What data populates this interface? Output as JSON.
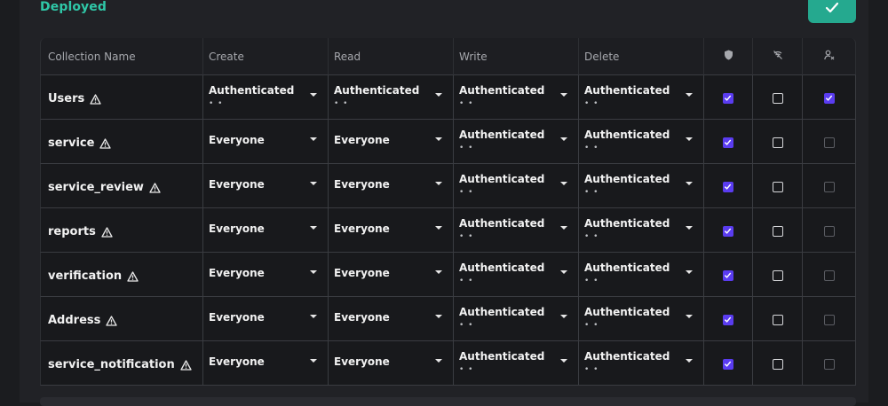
{
  "header": {
    "status_label": "Deployed",
    "deploy_button_icon": "check-icon",
    "accent_color": "#2fc8a8"
  },
  "table": {
    "columns": [
      "Collection Name",
      "Create",
      "Read",
      "Write",
      "Delete"
    ],
    "icon_columns": [
      "shield-icon",
      "no-signal-icon",
      "user-x-icon"
    ],
    "rows": [
      {
        "name": "Users",
        "create": "Authenticated",
        "read": "Authenticated",
        "write": "Authenticated",
        "delete": "Authenticated",
        "shield": true,
        "public": false,
        "self": true
      },
      {
        "name": "service",
        "create": "Everyone",
        "read": "Everyone",
        "write": "Authenticated",
        "delete": "Authenticated",
        "shield": true,
        "public": false,
        "self": false
      },
      {
        "name": "service_review",
        "create": "Everyone",
        "read": "Everyone",
        "write": "Authenticated",
        "delete": "Authenticated",
        "shield": true,
        "public": false,
        "self": false
      },
      {
        "name": "reports",
        "create": "Everyone",
        "read": "Everyone",
        "write": "Authenticated",
        "delete": "Authenticated",
        "shield": true,
        "public": false,
        "self": false
      },
      {
        "name": "verification",
        "create": "Everyone",
        "read": "Everyone",
        "write": "Authenticated",
        "delete": "Authenticated",
        "shield": true,
        "public": false,
        "self": false
      },
      {
        "name": "Address",
        "create": "Everyone",
        "read": "Everyone",
        "write": "Authenticated",
        "delete": "Authenticated",
        "shield": true,
        "public": false,
        "self": false
      },
      {
        "name": "service_notification",
        "create": "Everyone",
        "read": "Everyone",
        "write": "Authenticated",
        "delete": "Authenticated",
        "shield": true,
        "public": false,
        "self": false
      }
    ],
    "dots": "• •",
    "checkbox_color": "#5a3cf0"
  }
}
